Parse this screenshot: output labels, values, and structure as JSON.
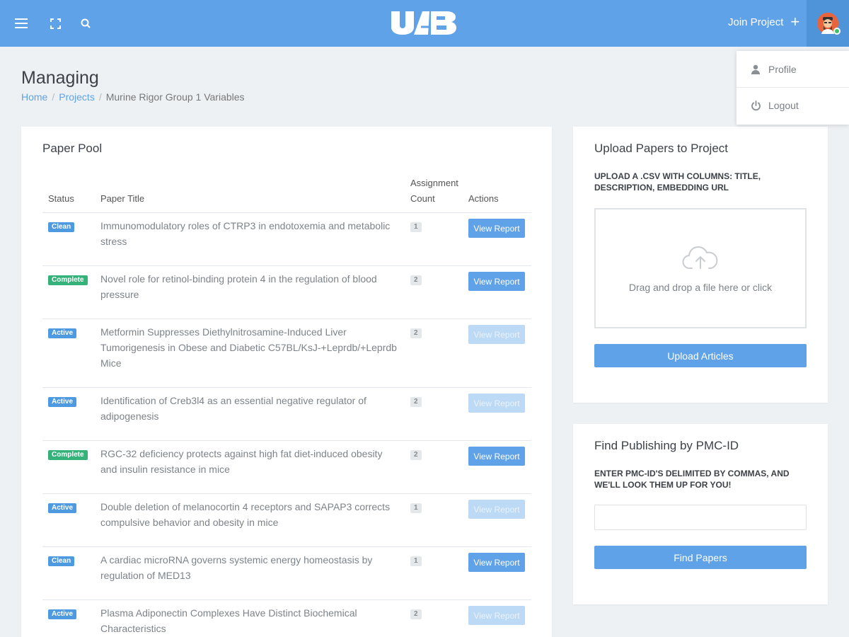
{
  "topbar": {
    "logo_text": "UAB",
    "join_label": "Join Project",
    "join_icon": "plus-icon",
    "menu_icon": "hamburger-icon",
    "fullscreen_icon": "fullscreen-icon",
    "search_icon": "search-icon",
    "brand_color": "#5fa2e7"
  },
  "user_menu": {
    "items": [
      {
        "label": "Profile",
        "icon": "user-icon"
      },
      {
        "label": "Logout",
        "icon": "power-icon"
      }
    ]
  },
  "header": {
    "title": "Managing",
    "breadcrumb": [
      "Home",
      "Projects",
      "Murine Rigor Group 1 Variables"
    ]
  },
  "paper_pool": {
    "title": "Paper Pool",
    "columns": {
      "status": "Status",
      "title": "Paper Title",
      "count_line1": "Assignment",
      "count_line2": "Count",
      "actions": "Actions"
    },
    "button_label": "View Report",
    "rows": [
      {
        "status": "Clean",
        "title": "Immunomodulatory roles of CTRP3 in endotoxemia and metabolic stress",
        "count": "1",
        "report_enabled": true
      },
      {
        "status": "Complete",
        "title": "Novel role for retinol-binding protein 4 in the regulation of blood pressure",
        "count": "2",
        "report_enabled": true
      },
      {
        "status": "Active",
        "title": "Metformin Suppresses Diethylnitrosamine-Induced Liver Tumorigenesis in Obese and Diabetic C57BL/KsJ-+Leprdb/+Leprdb Mice",
        "count": "2",
        "report_enabled": false
      },
      {
        "status": "Active",
        "title": "Identification of Creb3l4 as an essential negative regulator of adipogenesis",
        "count": "2",
        "report_enabled": false
      },
      {
        "status": "Complete",
        "title": "RGC-32 deficiency protects against high fat diet-induced obesity and insulin resistance in mice",
        "count": "2",
        "report_enabled": true
      },
      {
        "status": "Active",
        "title": "Double deletion of melanocortin 4 receptors and SAPAP3 corrects compulsive behavior and obesity in mice",
        "count": "1",
        "report_enabled": false
      },
      {
        "status": "Clean",
        "title": "A cardiac microRNA governs systemic energy homeostasis by regulation of MED13",
        "count": "1",
        "report_enabled": true
      },
      {
        "status": "Active",
        "title": "Plasma Adiponectin Complexes Have Distinct Biochemical Characteristics",
        "count": "2",
        "report_enabled": false
      }
    ]
  },
  "upload": {
    "title": "Upload Papers to Project",
    "instructions": "UPLOAD A .CSV WITH COLUMNS: TITLE, DESCRIPTION, EMBEDDING URL",
    "dropzone_text": "Drag and drop a file here or click",
    "dropzone_icon": "cloud-upload-icon",
    "button_label": "Upload Articles"
  },
  "find": {
    "title": "Find Publishing by PMC-ID",
    "instructions": "ENTER PMC-ID'S DELIMITED BY COMMAS, AND WE'LL LOOK THEM UP FOR YOU!",
    "input_value": "",
    "button_label": "Find Papers"
  }
}
